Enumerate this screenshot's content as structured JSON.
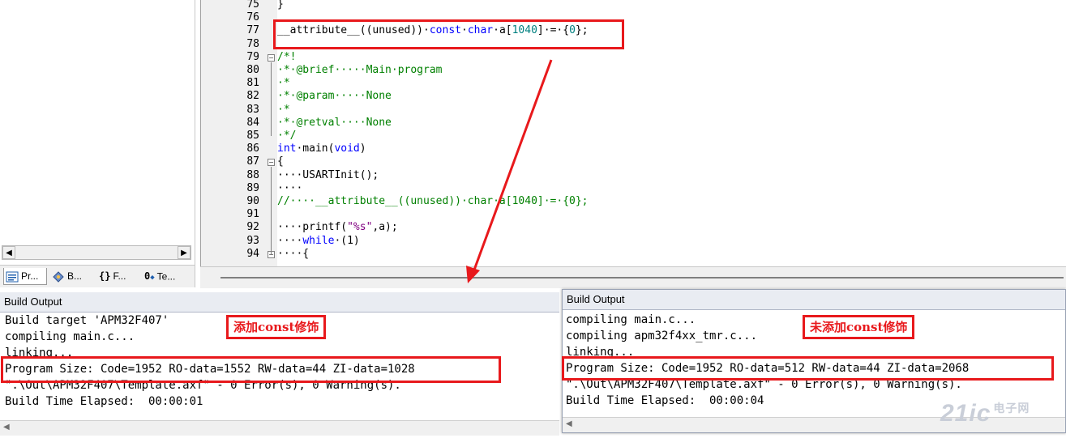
{
  "project_tabs": [
    {
      "label": "Pr...",
      "icon": "project-icon"
    },
    {
      "label": "B...",
      "icon": "books-icon"
    },
    {
      "label": "F...",
      "icon": "functions-icon"
    },
    {
      "label": "Te...",
      "icon": "templates-icon"
    }
  ],
  "editor": {
    "line_numbers": [
      "75",
      "76",
      "77",
      "78",
      "79",
      "80",
      "81",
      "82",
      "83",
      "84",
      "85",
      "86",
      "87",
      "88",
      "89",
      "90",
      "91",
      "92",
      "93",
      "94"
    ],
    "lines": [
      [
        {
          "t": "}",
          "c": ""
        }
      ],
      [],
      [
        {
          "t": "__attribute__((unused))·",
          "c": ""
        },
        {
          "t": "const",
          "c": "kw"
        },
        {
          "t": "·",
          "c": ""
        },
        {
          "t": "char",
          "c": "kw"
        },
        {
          "t": "·a[",
          "c": ""
        },
        {
          "t": "1040",
          "c": "num"
        },
        {
          "t": "]·=·{",
          "c": ""
        },
        {
          "t": "0",
          "c": "num"
        },
        {
          "t": "};",
          "c": ""
        }
      ],
      [],
      [
        {
          "t": "/*!",
          "c": "cm"
        }
      ],
      [
        {
          "t": "·*·@brief·····Main·program",
          "c": "cm"
        }
      ],
      [
        {
          "t": "·*",
          "c": "cm"
        }
      ],
      [
        {
          "t": "·*·@param·····None",
          "c": "cm"
        }
      ],
      [
        {
          "t": "·*",
          "c": "cm"
        }
      ],
      [
        {
          "t": "·*·@retval····None",
          "c": "cm"
        }
      ],
      [
        {
          "t": "·*/",
          "c": "cm"
        }
      ],
      [
        {
          "t": "int",
          "c": "kw"
        },
        {
          "t": "·main(",
          "c": ""
        },
        {
          "t": "void",
          "c": "kw"
        },
        {
          "t": ")",
          "c": ""
        }
      ],
      [
        {
          "t": "{",
          "c": ""
        }
      ],
      [
        {
          "t": "····USARTInit();",
          "c": ""
        }
      ],
      [
        {
          "t": "····",
          "c": ""
        }
      ],
      [
        {
          "t": "//····__attribute__((unused))·char·a[1040]·=·{0};",
          "c": "cm"
        }
      ],
      [],
      [
        {
          "t": "····printf(",
          "c": ""
        },
        {
          "t": "\"%s\"",
          "c": "str"
        },
        {
          "t": ",a);",
          "c": ""
        }
      ],
      [
        {
          "t": "····",
          "c": ""
        },
        {
          "t": "while",
          "c": "kw"
        },
        {
          "t": "·(1)",
          "c": ""
        }
      ],
      [
        {
          "t": "····{",
          "c": ""
        }
      ]
    ]
  },
  "build_left": {
    "title": "Build Output",
    "lines": [
      "Build target 'APM32F407'",
      "compiling main.c...",
      "linking...",
      "Program Size: Code=1952 RO-data=1552 RW-data=44 ZI-data=1028",
      "\".\\Out\\APM32F407\\Template.axf\" - 0 Error(s), 0 Warning(s).",
      "Build Time Elapsed:  00:00:01"
    ],
    "annotation": "添加const修饰"
  },
  "build_right": {
    "title": "Build Output",
    "lines": [
      "compiling main.c...",
      "compiling apm32f4xx_tmr.c...",
      "linking...",
      "Program Size: Code=1952 RO-data=512 RW-data=44 ZI-data=2068",
      "\".\\Out\\APM32F407\\Template.axf\" - 0 Error(s), 0 Warning(s).",
      "Build Time Elapsed:  00:00:04"
    ],
    "annotation": "未添加const修饰"
  },
  "watermark": {
    "main": "21ic",
    "sub": "电子网"
  },
  "colors": {
    "annotation_red": "#e8191c",
    "keyword": "#0000ff",
    "comment": "#008000",
    "number": "#008080"
  }
}
